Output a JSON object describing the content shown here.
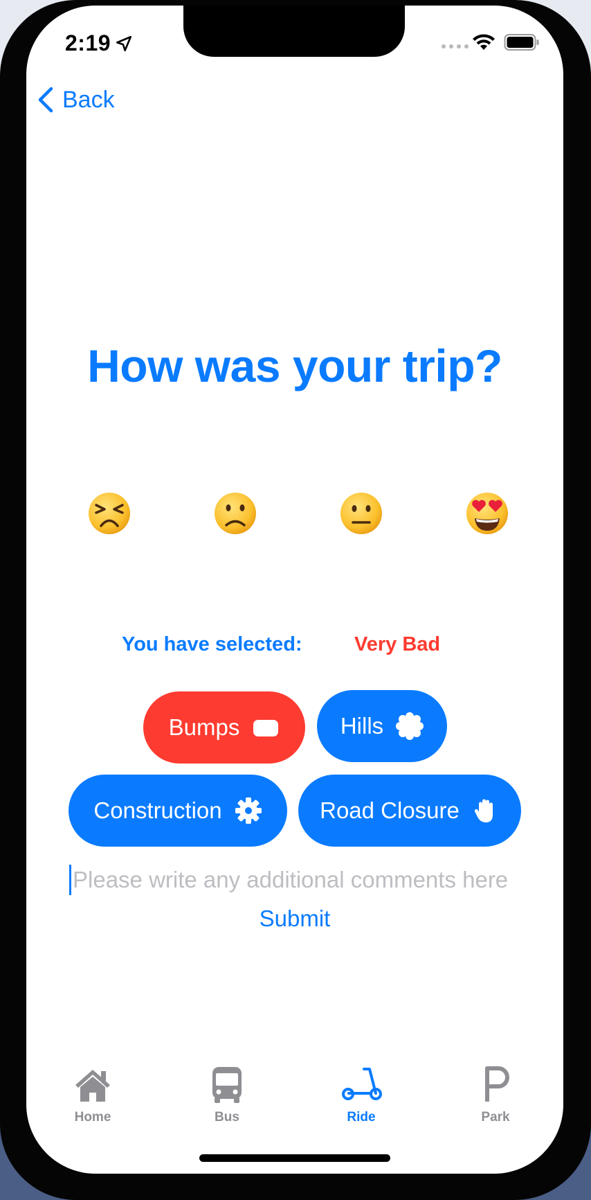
{
  "status_bar": {
    "time": "2:19"
  },
  "nav": {
    "back_label": "Back"
  },
  "title": "How was your trip?",
  "emojis": [
    {
      "name": "very-bad-face"
    },
    {
      "name": "bad-face"
    },
    {
      "name": "neutral-face"
    },
    {
      "name": "love-face"
    }
  ],
  "selection": {
    "label": "You have selected:",
    "value": "Very Bad",
    "label_color": "#0a7bff",
    "value_color": "#fe3b30"
  },
  "issues": [
    {
      "label": "Bumps",
      "icon": "pill-icon",
      "color": "#fe3b30",
      "selected": true
    },
    {
      "label": "Hills",
      "icon": "cog-badge-icon",
      "color": "#0a7bff",
      "selected": false
    },
    {
      "label": "Construction",
      "icon": "gear-icon",
      "color": "#0a7bff",
      "selected": false
    },
    {
      "label": "Road Closure",
      "icon": "hand-raised-icon",
      "color": "#0a7bff",
      "selected": false
    }
  ],
  "comment": {
    "placeholder": "Please write any additional comments here",
    "value": ""
  },
  "submit_label": "Submit",
  "tabs": [
    {
      "label": "Home",
      "icon": "house-icon",
      "active": false
    },
    {
      "label": "Bus",
      "icon": "bus-icon",
      "active": false
    },
    {
      "label": "Ride",
      "icon": "scooter-icon",
      "active": true
    },
    {
      "label": "Park",
      "icon": "parking-icon",
      "active": false
    }
  ],
  "colors": {
    "accent": "#0a7bff",
    "danger": "#fe3b30",
    "inactive": "#8e8e93"
  }
}
